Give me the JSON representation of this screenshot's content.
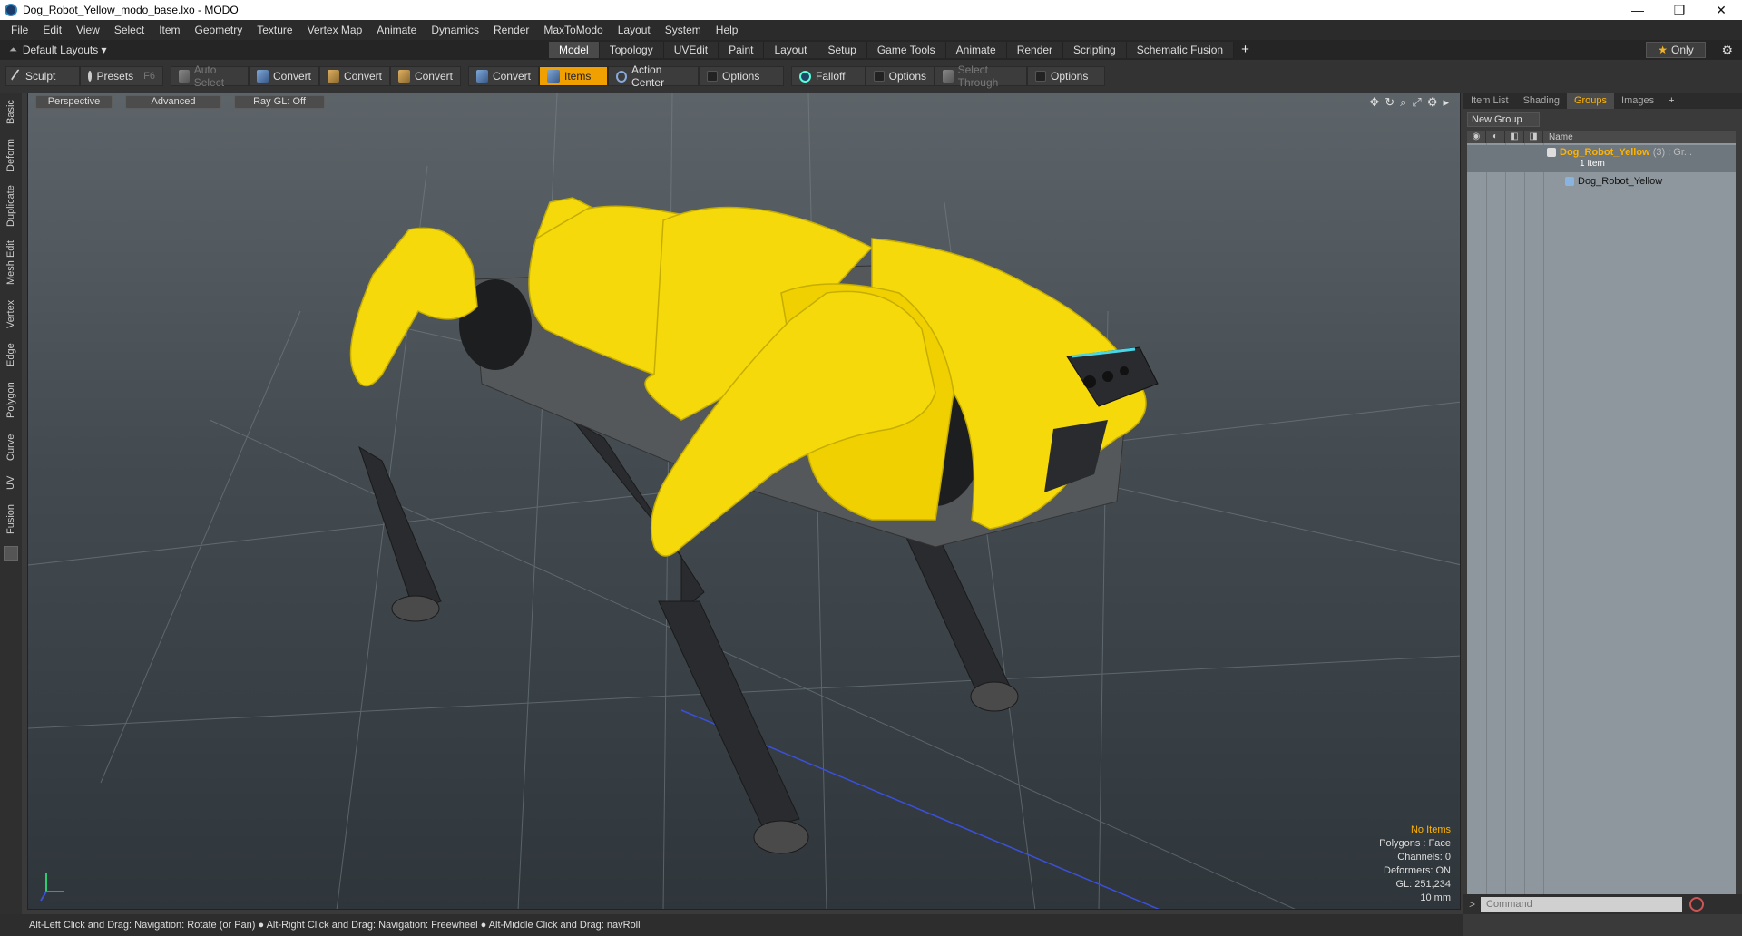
{
  "window": {
    "title": "Dog_Robot_Yellow_modo_base.lxo - MODO",
    "controls": [
      "—",
      "❐",
      "✕"
    ]
  },
  "menubar": [
    "File",
    "Edit",
    "View",
    "Select",
    "Item",
    "Geometry",
    "Texture",
    "Vertex Map",
    "Animate",
    "Dynamics",
    "Render",
    "MaxToModo",
    "Layout",
    "System",
    "Help"
  ],
  "layoutbar": {
    "layout_label": "Default Layouts ▾",
    "tabs": [
      "Model",
      "Topology",
      "UVEdit",
      "Paint",
      "Layout",
      "Setup",
      "Game Tools",
      "Animate",
      "Render",
      "Scripting",
      "Schematic Fusion"
    ],
    "active_tab": "Model",
    "only_label": "Only"
  },
  "toolbar": {
    "sculpt": "Sculpt",
    "presets": "Presets",
    "presets_key": "F6",
    "auto_select": "Auto Select",
    "convert": "Convert",
    "items": "Items",
    "action_center": "Action Center",
    "options": "Options",
    "falloff": "Falloff",
    "select_through": "Select Through"
  },
  "left_tabs": [
    "Basic",
    "Deform",
    "Duplicate",
    "Mesh Edit",
    "Vertex",
    "Edge",
    "Polygon",
    "Curve",
    "UV",
    "Fusion"
  ],
  "viewport": {
    "view_mode": "Perspective",
    "advanced": "Advanced",
    "raygl": "Ray GL: Off",
    "stats": {
      "selection": "No Items",
      "polygons": "Polygons : Face",
      "channels": "Channels: 0",
      "deformers": "Deformers: ON",
      "gl": "GL: 251,234",
      "scale": "10 mm"
    },
    "model_color": "#f5d90a"
  },
  "right_panel": {
    "tabs": [
      "Item List",
      "Shading",
      "Groups",
      "Images"
    ],
    "active_tab": "Groups",
    "new_group": "New Group",
    "header_name": "Name",
    "group": {
      "name": "Dog_Robot_Yellow",
      "count": "(3) : Gr...",
      "sub": "1 Item"
    },
    "item": {
      "name": "Dog_Robot_Yellow"
    },
    "command_placeholder": "Command"
  },
  "statusbar": {
    "text": "Alt-Left Click and Drag: Navigation: Rotate (or Pan) ● Alt-Right Click and Drag: Navigation: Freewheel ● Alt-Middle Click and Drag: navRoll"
  },
  "colors": {
    "accent": "#f0a000",
    "highlight": "#ffb300"
  }
}
